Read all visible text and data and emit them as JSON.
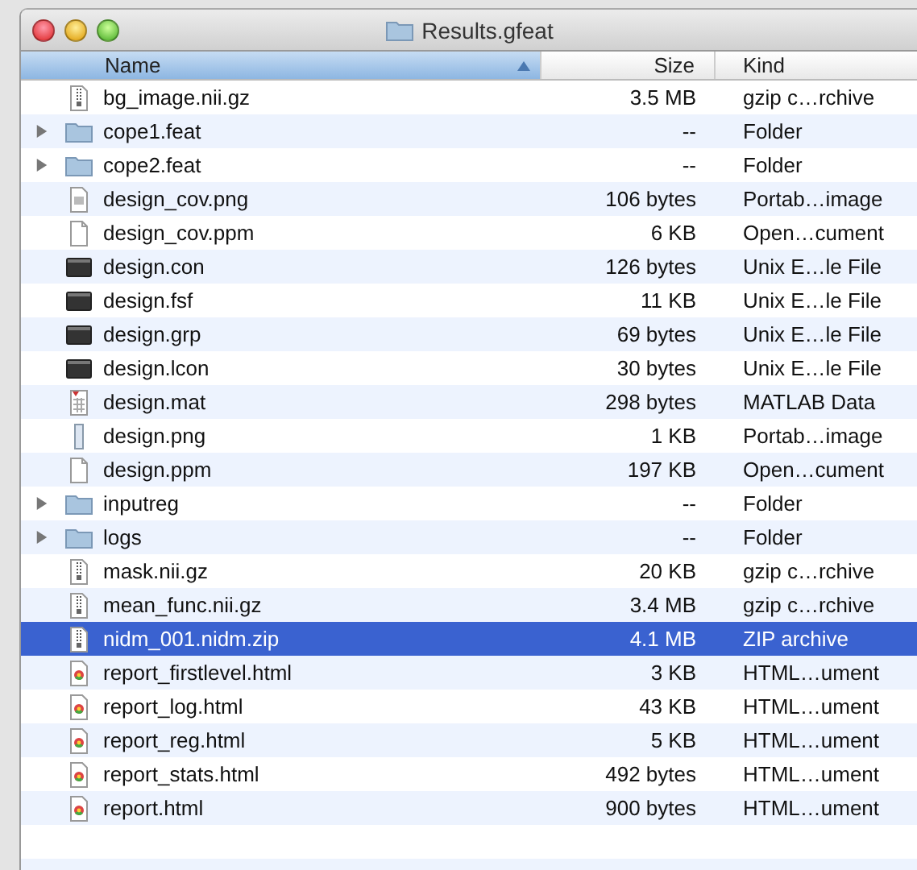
{
  "window": {
    "title": "Results.gfeat"
  },
  "columns": [
    {
      "label": "Name",
      "selected": true
    },
    {
      "label": "Size",
      "selected": false
    },
    {
      "label": "Kind",
      "selected": false
    }
  ],
  "rows": [
    {
      "name": "bg_image.nii.gz",
      "size": "3.5 MB",
      "type": "gzip c…rchive",
      "kind": "archive",
      "selected": false
    },
    {
      "name": "cope1.feat",
      "size": "--",
      "type": "Folder",
      "kind": "folder",
      "expanded": false,
      "selected": false
    },
    {
      "name": "cope2.feat",
      "size": "--",
      "type": "Folder",
      "kind": "folder",
      "expanded": false,
      "selected": false
    },
    {
      "name": "design_cov.png",
      "size": "106 bytes",
      "type": "Portab…image",
      "kind": "image",
      "selected": false
    },
    {
      "name": "design_cov.ppm",
      "size": "6 KB",
      "type": "Open…cument",
      "kind": "document",
      "selected": false
    },
    {
      "name": "design.con",
      "size": "126 bytes",
      "type": "Unix E…le File",
      "kind": "executable",
      "selected": false
    },
    {
      "name": "design.fsf",
      "size": "11 KB",
      "type": "Unix E…le File",
      "kind": "executable",
      "selected": false
    },
    {
      "name": "design.grp",
      "size": "69 bytes",
      "type": "Unix E…le File",
      "kind": "executable",
      "selected": false
    },
    {
      "name": "design.lcon",
      "size": "30 bytes",
      "type": "Unix E…le File",
      "kind": "executable",
      "selected": false
    },
    {
      "name": "design.mat",
      "size": "298 bytes",
      "type": "MATLAB Data",
      "kind": "matlab",
      "selected": false
    },
    {
      "name": "design.png",
      "size": "1 KB",
      "type": "Portab…image",
      "kind": "bitmap",
      "selected": false
    },
    {
      "name": "design.ppm",
      "size": "197 KB",
      "type": "Open…cument",
      "kind": "document",
      "selected": false
    },
    {
      "name": "inputreg",
      "size": "--",
      "type": "Folder",
      "kind": "folder",
      "expanded": false,
      "selected": false
    },
    {
      "name": "logs",
      "size": "--",
      "type": "Folder",
      "kind": "folder",
      "expanded": false,
      "selected": false
    },
    {
      "name": "mask.nii.gz",
      "size": "20 KB",
      "type": "gzip c…rchive",
      "kind": "archive",
      "selected": false
    },
    {
      "name": "mean_func.nii.gz",
      "size": "3.4 MB",
      "type": "gzip c…rchive",
      "kind": "archive",
      "selected": false
    },
    {
      "name": "nidm_001.nidm.zip",
      "size": "4.1 MB",
      "type": "ZIP archive",
      "kind": "archive",
      "selected": true
    },
    {
      "name": "report_firstlevel.html",
      "size": "3 KB",
      "type": "HTML…ument",
      "kind": "html",
      "selected": false
    },
    {
      "name": "report_log.html",
      "size": "43 KB",
      "type": "HTML…ument",
      "kind": "html",
      "selected": false
    },
    {
      "name": "report_reg.html",
      "size": "5 KB",
      "type": "HTML…ument",
      "kind": "html",
      "selected": false
    },
    {
      "name": "report_stats.html",
      "size": "492 bytes",
      "type": "HTML…ument",
      "kind": "html",
      "selected": false
    },
    {
      "name": "report.html",
      "size": "900 bytes",
      "type": "HTML…ument",
      "kind": "html",
      "selected": false
    }
  ]
}
